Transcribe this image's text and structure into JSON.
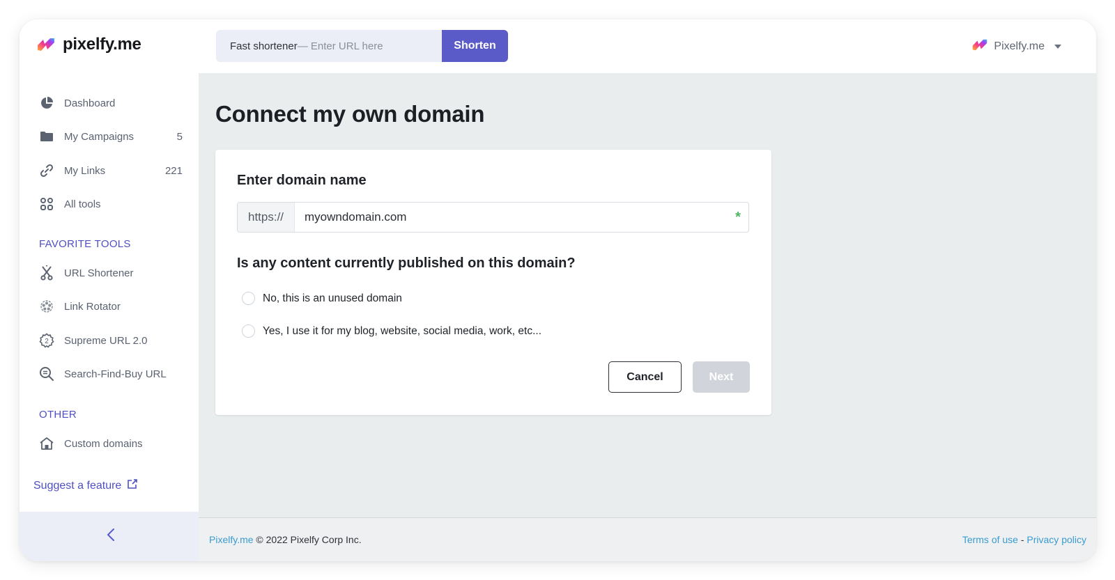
{
  "brand": {
    "name": "pixelfy.me",
    "logo_icon": "pixelfy-bolt-logo",
    "colors": {
      "accent": "#5a5bc9",
      "section_title": "#4f4fc4",
      "link": "#3a9bd0",
      "required": "#4fb860"
    }
  },
  "header": {
    "shortener": {
      "prefix": "Fast shortener",
      "placeholder": "— Enter URL here",
      "button_label": "Shorten"
    },
    "account": {
      "name": "Pixelfy.me",
      "icon": "pixelfy-bolt-logo",
      "dropdown_icon": "caret-down-icon"
    }
  },
  "sidebar": {
    "items": [
      {
        "label": "Dashboard",
        "icon": "pie-chart-icon",
        "count": ""
      },
      {
        "label": "My Campaigns",
        "icon": "folder-icon",
        "count": "5"
      },
      {
        "label": "My Links",
        "icon": "link-icon",
        "count": "221"
      },
      {
        "label": "All tools",
        "icon": "grid-icon",
        "count": ""
      }
    ],
    "favorite_tools_title": "FAVORITE TOOLS",
    "favorite_tools": [
      {
        "label": "URL Shortener",
        "icon": "scissors-icon"
      },
      {
        "label": "Link Rotator",
        "icon": "rotator-icon"
      },
      {
        "label": "Supreme URL 2.0",
        "icon": "badge-2-icon"
      },
      {
        "label": "Search-Find-Buy URL",
        "icon": "search-icon"
      }
    ],
    "other_title": "OTHER",
    "other": [
      {
        "label": "Custom domains",
        "icon": "home-icon"
      }
    ],
    "suggest_feature": "Suggest a feature",
    "collapse_icon": "chevron-left-icon"
  },
  "main": {
    "title": "Connect my own domain",
    "card": {
      "domain_label": "Enter domain name",
      "domain_prefix": "https://",
      "domain_value": "myowndomain.com",
      "required_mark": "*",
      "question": "Is any content currently published on this domain?",
      "options": [
        {
          "label": "No, this is an unused domain",
          "selected": false
        },
        {
          "label": "Yes, I use it for my blog, website, social media, work, etc...",
          "selected": false
        }
      ],
      "cancel_label": "Cancel",
      "next_label": "Next"
    }
  },
  "footer": {
    "brand_link": "Pixelfy.me",
    "copyright": " © 2022 Pixelfy Corp Inc.",
    "terms": "Terms of use",
    "separator": " - ",
    "privacy": "Privacy policy"
  }
}
